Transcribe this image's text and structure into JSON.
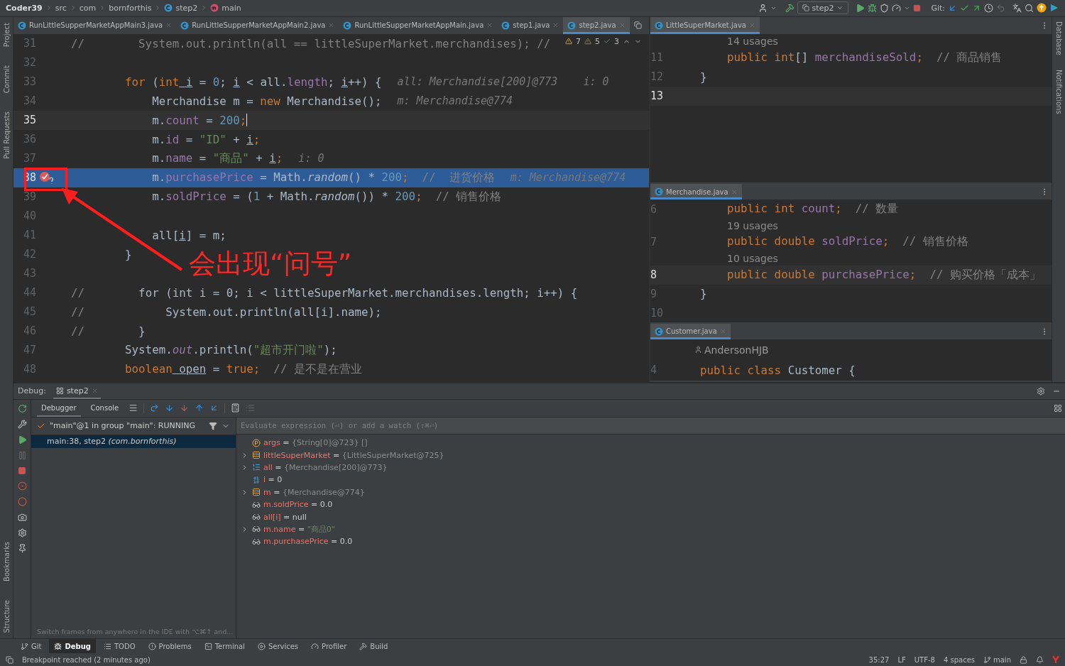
{
  "navbar": {
    "breadcrumbs": [
      {
        "label": "Coder39",
        "kind": "project"
      },
      {
        "label": "src",
        "kind": "folder"
      },
      {
        "label": "com",
        "kind": "folder"
      },
      {
        "label": "bornforthis",
        "kind": "folder"
      },
      {
        "label": "step2",
        "kind": "class"
      },
      {
        "label": "main",
        "kind": "method"
      }
    ],
    "run_config": "step2",
    "git_label": "Git:"
  },
  "editor": {
    "tabs": [
      {
        "label": "RunLittleSupperMarketAppMain3.java",
        "selected": false
      },
      {
        "label": "RunLittleSupperMarketAppMain2.java",
        "selected": false
      },
      {
        "label": "RunLittleSupperMarketAppMain.java",
        "selected": false
      },
      {
        "label": "step1.java",
        "selected": false
      },
      {
        "label": "step2.java",
        "selected": true
      }
    ],
    "inspections": {
      "warnings": "7",
      "weak_warnings": "5",
      "ok": "3"
    },
    "lines": [
      {
        "number": "31",
        "caret_line": false,
        "execution_point": false,
        "segments": [
          {
            "text": "//        System.out.println(all == littleSuperMarket.merchandises); //",
            "kind": "comment"
          }
        ]
      },
      {
        "number": "32",
        "caret_line": false,
        "execution_point": false
      },
      {
        "number": "33",
        "caret_line": false,
        "execution_point": false,
        "segments": [
          {
            "text": "        for",
            "kind": "keyword"
          },
          {
            "text": " (",
            "kind": "plain"
          },
          {
            "text": "int",
            "kind": "keyword"
          },
          {
            "text": " i",
            "kind": "local"
          },
          {
            "text": " = ",
            "kind": "plain"
          },
          {
            "text": "0",
            "kind": "number"
          },
          {
            "text": "; ",
            "kind": "plain"
          },
          {
            "text": "i",
            "kind": "local"
          },
          {
            "text": " < all.",
            "kind": "plain"
          },
          {
            "text": "length",
            "kind": "field"
          },
          {
            "text": "; ",
            "kind": "plain"
          },
          {
            "text": "i",
            "kind": "local"
          },
          {
            "text": "++) {",
            "kind": "plain"
          }
        ],
        "hint": "all: Merchandise[200]@773    i: 0"
      },
      {
        "number": "34",
        "caret_line": false,
        "execution_point": false,
        "segments": [
          {
            "text": "            Merchandise m = ",
            "kind": "plain"
          },
          {
            "text": "new",
            "kind": "keyword"
          },
          {
            "text": " Merchandise();",
            "kind": "plain"
          }
        ],
        "hint": "m: Merchandise@774"
      },
      {
        "number": "35",
        "caret_line": true,
        "execution_point": false,
        "segments": [
          {
            "text": "            m.",
            "kind": "plain"
          },
          {
            "text": "count",
            "kind": "field"
          },
          {
            "text": " = ",
            "kind": "plain"
          },
          {
            "text": "200",
            "kind": "number"
          },
          {
            "text": ";",
            "kind": "keyword"
          }
        ]
      },
      {
        "number": "36",
        "caret_line": false,
        "execution_point": false,
        "segments": [
          {
            "text": "            m.",
            "kind": "plain"
          },
          {
            "text": "id",
            "kind": "field"
          },
          {
            "text": " = ",
            "kind": "plain"
          },
          {
            "text": "\"ID\"",
            "kind": "string"
          },
          {
            "text": " + ",
            "kind": "plain"
          },
          {
            "text": "i",
            "kind": "local"
          },
          {
            "text": ";",
            "kind": "keyword"
          }
        ]
      },
      {
        "number": "37",
        "caret_line": false,
        "execution_point": false,
        "segments": [
          {
            "text": "            m.",
            "kind": "plain"
          },
          {
            "text": "name",
            "kind": "field"
          },
          {
            "text": " = ",
            "kind": "plain"
          },
          {
            "text": "\"商品\"",
            "kind": "string"
          },
          {
            "text": " + ",
            "kind": "plain"
          },
          {
            "text": "i",
            "kind": "local"
          },
          {
            "text": ";",
            "kind": "keyword"
          }
        ],
        "hint": "i: 0"
      },
      {
        "number": "38",
        "caret_line": false,
        "execution_point": true,
        "segments": [
          {
            "text": "            m.",
            "kind": "plain"
          },
          {
            "text": "purchasePrice",
            "kind": "field"
          },
          {
            "text": " = Math.",
            "kind": "plain"
          },
          {
            "text": "random",
            "kind": "static"
          },
          {
            "text": "() * ",
            "kind": "plain"
          },
          {
            "text": "200",
            "kind": "number"
          },
          {
            "text": ";",
            "kind": "keyword"
          },
          {
            "text": "  //  进货价格",
            "kind": "comment"
          }
        ],
        "hint": "m: Merchandise@774"
      },
      {
        "number": "39",
        "caret_line": false,
        "execution_point": false,
        "segments": [
          {
            "text": "            m.",
            "kind": "plain"
          },
          {
            "text": "soldPrice",
            "kind": "field"
          },
          {
            "text": " = (",
            "kind": "plain"
          },
          {
            "text": "1",
            "kind": "number"
          },
          {
            "text": " + Math.",
            "kind": "plain"
          },
          {
            "text": "random",
            "kind": "static"
          },
          {
            "text": "()) * ",
            "kind": "plain"
          },
          {
            "text": "200",
            "kind": "number"
          },
          {
            "text": ";",
            "kind": "keyword"
          },
          {
            "text": "  // 销售价格",
            "kind": "comment"
          }
        ]
      },
      {
        "number": "40",
        "caret_line": false,
        "execution_point": false
      },
      {
        "number": "41",
        "caret_line": false,
        "execution_point": false,
        "segments": [
          {
            "text": "            all[",
            "kind": "plain"
          },
          {
            "text": "i",
            "kind": "local"
          },
          {
            "text": "] = m;",
            "kind": "plain"
          }
        ]
      },
      {
        "number": "42",
        "caret_line": false,
        "execution_point": false,
        "segments": [
          {
            "text": "        }",
            "kind": "plain"
          }
        ]
      },
      {
        "number": "43",
        "caret_line": false,
        "execution_point": false
      },
      {
        "number": "44",
        "caret_line": false,
        "execution_point": false,
        "segments": [
          {
            "text": "//",
            "kind": "comment"
          },
          {
            "text": "        for (int i = 0; i < littleSuperMarket.merchandises.length; i++) {",
            "kind": "plain"
          }
        ]
      },
      {
        "number": "45",
        "caret_line": false,
        "execution_point": false,
        "segments": [
          {
            "text": "//",
            "kind": "comment"
          },
          {
            "text": "            System.out.println(all[i].name);",
            "kind": "plain"
          }
        ]
      },
      {
        "number": "46",
        "caret_line": false,
        "execution_point": false,
        "segments": [
          {
            "text": "//",
            "kind": "comment"
          },
          {
            "text": "        }",
            "kind": "plain"
          }
        ]
      },
      {
        "number": "47",
        "caret_line": false,
        "execution_point": false,
        "segments": [
          {
            "text": "        System.",
            "kind": "plain"
          },
          {
            "text": "out",
            "kind": "static_field"
          },
          {
            "text": ".println(",
            "kind": "plain"
          },
          {
            "text": "\"超市开门啦\"",
            "kind": "string"
          },
          {
            "text": ");",
            "kind": "plain"
          }
        ]
      },
      {
        "number": "48",
        "caret_line": false,
        "execution_point": false,
        "segments": [
          {
            "text": "        boolean",
            "kind": "keyword"
          },
          {
            "text": " open",
            "kind": "local"
          },
          {
            "text": " = ",
            "kind": "plain"
          },
          {
            "text": "true",
            "kind": "keyword"
          },
          {
            "text": ";",
            "kind": "keyword"
          },
          {
            "text": "  // 是不是在营业",
            "kind": "comment"
          }
        ]
      }
    ],
    "annotation": {
      "text": "会出现“问号”"
    }
  },
  "panes": [
    {
      "tab": "LittleSuperMarket.java",
      "lines": [
        {
          "kind": "usages",
          "text": "14 usages"
        },
        {
          "kind": "code",
          "number": "11",
          "caret_line": false,
          "segments": [
            {
              "text": "    public int",
              "kind": "keyword"
            },
            {
              "text": "[] ",
              "kind": "plain"
            },
            {
              "text": "merchandiseSold",
              "kind": "field"
            },
            {
              "text": ";",
              "kind": "keyword"
            },
            {
              "text": "  // 商品销售",
              "kind": "comment"
            }
          ]
        },
        {
          "kind": "code",
          "number": "12",
          "caret_line": false,
          "segments": [
            {
              "text": "}",
              "kind": "plain"
            }
          ]
        },
        {
          "kind": "code",
          "number": "13",
          "caret_line": true
        }
      ]
    },
    {
      "tab": "Merchandise.java",
      "lines": [
        {
          "kind": "code",
          "number": "6",
          "caret_line": false,
          "segments": [
            {
              "text": "    public int ",
              "kind": "keyword"
            },
            {
              "text": "count",
              "kind": "field"
            },
            {
              "text": ";",
              "kind": "keyword"
            },
            {
              "text": "  // 数量",
              "kind": "comment"
            }
          ]
        },
        {
          "kind": "usages",
          "text": "19 usages"
        },
        {
          "kind": "code",
          "number": "7",
          "caret_line": false,
          "segments": [
            {
              "text": "    public double ",
              "kind": "keyword"
            },
            {
              "text": "soldPrice",
              "kind": "field"
            },
            {
              "text": ";",
              "kind": "keyword"
            },
            {
              "text": "  // 销售价格",
              "kind": "comment"
            }
          ]
        },
        {
          "kind": "usages",
          "text": "10 usages"
        },
        {
          "kind": "code",
          "number": "8",
          "caret_line": true,
          "segments": [
            {
              "text": "    public double ",
              "kind": "keyword"
            },
            {
              "text": "purchasePrice",
              "kind": "field"
            },
            {
              "text": ";",
              "kind": "keyword"
            },
            {
              "text": "  // 购买价格「成本」",
              "kind": "comment"
            }
          ]
        },
        {
          "kind": "code",
          "number": "9",
          "caret_line": false,
          "segments": [
            {
              "text": "}",
              "kind": "plain"
            }
          ]
        },
        {
          "kind": "code",
          "number": "10",
          "caret_line": false
        }
      ]
    },
    {
      "tab": "Customer.java",
      "lines": [
        {
          "kind": "author",
          "text": "AndersonHJB"
        },
        {
          "kind": "code",
          "number": "4",
          "caret_line": false,
          "segments": [
            {
              "text": "public class ",
              "kind": "keyword"
            },
            {
              "text": "Customer {",
              "kind": "plain"
            }
          ]
        }
      ]
    }
  ],
  "left_strip": {
    "top": [
      "Project",
      "Commit",
      "Pull Requests"
    ],
    "bottom": [
      "Bookmarks",
      "Structure"
    ]
  },
  "right_strip": [
    "Database",
    "Notifications"
  ],
  "debug": {
    "title": "Debug:",
    "session": "step2",
    "tabs": [
      {
        "label": "Debugger",
        "selected": true
      },
      {
        "label": "Console",
        "selected": false
      }
    ],
    "thread": "\"main\"@1 in group \"main\": RUNNING",
    "frames": [
      {
        "text": "main:38, step2 *(com.bornforthis)*",
        "selected": true
      }
    ],
    "evaluate_placeholder": "Evaluate expression (⏎) or add a watch (⇧⌘⏎)",
    "variables": [
      {
        "name": "args",
        "operator": "=",
        "value": {
          "text": "{String[0]@723} []",
          "kind": "object"
        },
        "kind": "param",
        "expandable": false
      },
      {
        "name": "littleSuperMarket",
        "operator": "=",
        "value": {
          "text": "{LittleSuperMarket@725}",
          "kind": "object"
        },
        "kind": "field",
        "expandable": true
      },
      {
        "name": "all",
        "operator": "=",
        "value": {
          "text": "{Merchandise[200]@773}",
          "kind": "object"
        },
        "kind": "array",
        "expandable": true
      },
      {
        "name": "i",
        "operator": "=",
        "value": {
          "text": "0",
          "kind": "plain"
        },
        "kind": "primitive",
        "expandable": false
      },
      {
        "name": "m",
        "operator": "=",
        "value": {
          "text": "{Merchandise@774}",
          "kind": "object"
        },
        "kind": "field",
        "expandable": true
      },
      {
        "name": "m.soldPrice",
        "operator": "=",
        "value": {
          "text": "0.0",
          "kind": "plain"
        },
        "kind": "watch",
        "expandable": false
      },
      {
        "name": "all[i]",
        "operator": "=",
        "value": {
          "text": "null",
          "kind": "plain"
        },
        "kind": "watch",
        "expandable": false
      },
      {
        "name": "m.name",
        "operator": "=",
        "value": {
          "text": "\"商品0\"",
          "kind": "string"
        },
        "kind": "watch",
        "expandable": true
      },
      {
        "name": "m.purchasePrice",
        "operator": "=",
        "value": {
          "text": "0.0",
          "kind": "plain"
        },
        "kind": "watch",
        "expandable": false
      }
    ],
    "tip": "Switch frames from anywhere in the IDE with ⌥⌘↑ and..."
  },
  "tool_windows": [
    {
      "label": "Git",
      "kind": "git",
      "selected": false
    },
    {
      "label": "Debug",
      "kind": "debug",
      "selected": true
    },
    {
      "label": "TODO",
      "kind": "todo",
      "selected": false
    },
    {
      "label": "Problems",
      "kind": "problems",
      "selected": false
    },
    {
      "label": "Terminal",
      "kind": "terminal",
      "selected": false
    },
    {
      "label": "Services",
      "kind": "services",
      "selected": false
    },
    {
      "label": "Profiler",
      "kind": "profiler",
      "selected": false
    },
    {
      "label": "Build",
      "kind": "build",
      "selected": false
    }
  ],
  "status_bar": {
    "message": "Breakpoint reached (2 minutes ago)",
    "position": "35:27",
    "line_separator": "LF",
    "encoding": "UTF-8",
    "indent": "4 spaces",
    "branch": "main"
  }
}
